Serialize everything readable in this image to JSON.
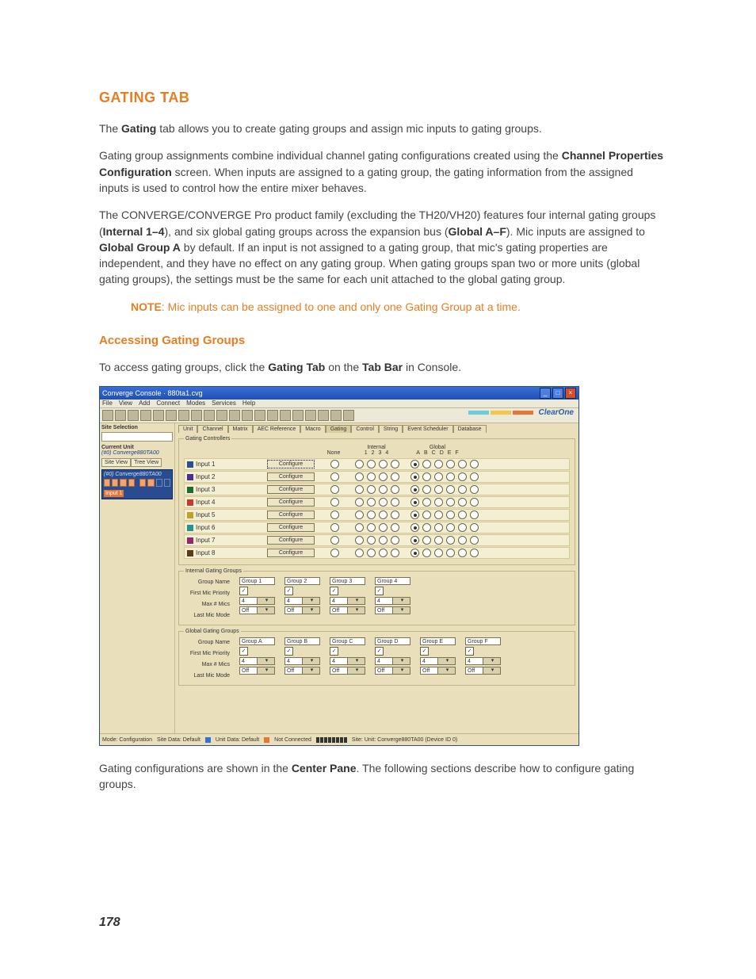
{
  "doc": {
    "title": "GATING TAB",
    "p1a": "The ",
    "p1b": "Gating",
    "p1c": " tab allows you to create gating groups and assign mic inputs to gating groups.",
    "p2a": "Gating group assignments combine individual channel gating configurations created using the ",
    "p2b": "Channel Properties Configuration",
    "p2c": " screen. When inputs are assigned to a gating group, the gating information from the assigned inputs is used to control how the entire mixer behaves.",
    "p3a": "The CONVERGE/CONVERGE Pro product family (excluding the TH20/VH20) features four internal gating groups (",
    "p3b": "Internal 1–4",
    "p3c": "), and six global gating groups across the expansion bus (",
    "p3d": "Global A–F",
    "p3e": "). Mic inputs are assigned to ",
    "p3f": "Global Group A",
    "p3g": " by default. If an input is not assigned to a gating group, that mic's gating properties are independent, and they have no effect on any gating group. When gating groups span two or more units (global gating groups), the settings must be the same for each unit attached to the global gating group.",
    "note_label": "NOTE",
    "note_body": ": Mic inputs can be assigned to one and only one Gating Group at a time.",
    "sub1": "Accessing Gating Groups",
    "p4a": "To access gating groups, click the ",
    "p4b": "Gating Tab",
    "p4c": " on the ",
    "p4d": "Tab Bar",
    "p4e": " in Console.",
    "p5a": "Gating configurations are shown in the ",
    "p5b": "Center Pane",
    "p5c": ". The following sections describe how to configure gating groups.",
    "page_number": "178"
  },
  "win": {
    "title": "Converge Console · 880ta1.cvg",
    "brand": "ClearOne",
    "menus": [
      "File",
      "View",
      "Add",
      "Connect",
      "Modes",
      "Services",
      "Help"
    ],
    "tabs": [
      "Unit",
      "Channel",
      "Matrix",
      "AEC Reference",
      "Macro",
      "Gating",
      "Control",
      "String",
      "Event Scheduler",
      "Database"
    ],
    "active_tab": "Gating",
    "sidebar": {
      "site_label": "Site Selection",
      "current_unit_label": "Current Unit",
      "current_unit_value": "(#0) Converge880TA00",
      "view_tabs": [
        "Site View",
        "Tree View"
      ],
      "device_line": "(#0) Converge880TA00",
      "input_selected": "Input 1"
    },
    "controllers_legend": "Gating Controllers",
    "hdr": {
      "none": "None",
      "internal": "Internal",
      "global": "Global",
      "internal_cols": [
        "1",
        "2",
        "3",
        "4"
      ],
      "global_cols": [
        "A",
        "B",
        "C",
        "D",
        "E",
        "F"
      ]
    },
    "inputs": [
      "Input 1",
      "Input 2",
      "Input 3",
      "Input 4",
      "Input 5",
      "Input 6",
      "Input 7",
      "Input 8"
    ],
    "configure_label": "Configure",
    "igg": {
      "legend": "Internal Gating Groups",
      "row_labels": [
        "Group Name",
        "First Mic Priority",
        "Max # Mics",
        "Last Mic Mode"
      ],
      "groups": [
        {
          "name": "Group 1",
          "fmp": true,
          "max": "4",
          "last": "Off"
        },
        {
          "name": "Group 2",
          "fmp": true,
          "max": "4",
          "last": "Off"
        },
        {
          "name": "Group 3",
          "fmp": true,
          "max": "4",
          "last": "Off"
        },
        {
          "name": "Group 4",
          "fmp": true,
          "max": "4",
          "last": "Off"
        }
      ]
    },
    "ggg": {
      "legend": "Global Gating Groups",
      "row_labels": [
        "Group Name",
        "First Mic Priority",
        "Max # Mics",
        "Last Mic Mode"
      ],
      "groups": [
        {
          "name": "Group A",
          "fmp": true,
          "max": "4",
          "last": "Off"
        },
        {
          "name": "Group B",
          "fmp": true,
          "max": "4",
          "last": "Off"
        },
        {
          "name": "Group C",
          "fmp": true,
          "max": "4",
          "last": "Off"
        },
        {
          "name": "Group D",
          "fmp": true,
          "max": "4",
          "last": "Off"
        },
        {
          "name": "Group E",
          "fmp": true,
          "max": "4",
          "last": "Off"
        },
        {
          "name": "Group F",
          "fmp": true,
          "max": "4",
          "last": "Off"
        }
      ]
    },
    "status": {
      "mode": "Mode: Configuration",
      "site": "Site Data: Default",
      "unit": "Unit Data: Default",
      "conn": "Not Connected",
      "loc": "Site:   Unit: Converge880TA00 (Device ID 0)"
    }
  }
}
